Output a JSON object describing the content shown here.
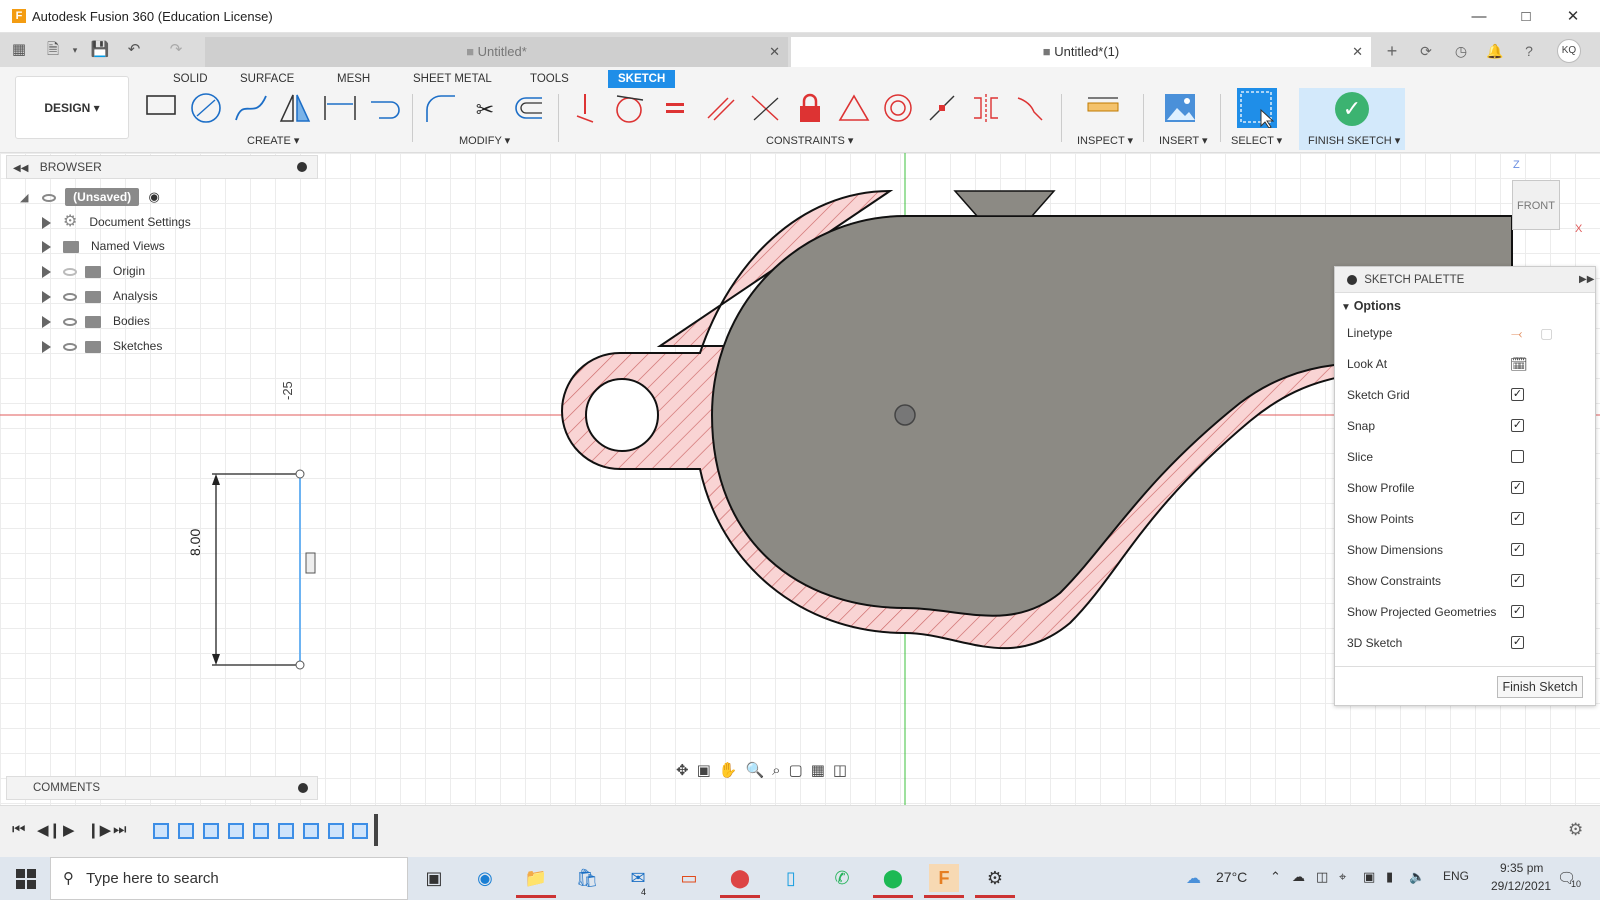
{
  "window": {
    "title": "Autodesk Fusion 360 (Education License)",
    "logo_letter": "F"
  },
  "tabs": [
    {
      "label": "Untitled*",
      "active": false
    },
    {
      "label": "Untitled*(1)",
      "active": true
    }
  ],
  "user_initials": "KQ",
  "workspace": {
    "label": "DESIGN ▾"
  },
  "ribbon_tabs": [
    "SOLID",
    "SURFACE",
    "MESH",
    "SHEET METAL",
    "TOOLS",
    "SKETCH"
  ],
  "ribbon_groups": {
    "create": "CREATE ▾",
    "modify": "MODIFY ▾",
    "constraints": "CONSTRAINTS ▾",
    "inspect": "INSPECT ▾",
    "insert": "INSERT ▾",
    "select": "SELECT ▾",
    "finish": "FINISH SKETCH ▾"
  },
  "browser": {
    "title": "BROWSER",
    "root": "(Unsaved)",
    "items": [
      "Document Settings",
      "Named Views",
      "Origin",
      "Analysis",
      "Bodies",
      "Sketches"
    ]
  },
  "comments": {
    "title": "COMMENTS"
  },
  "dimensions": {
    "horizontal": "-25",
    "vertical": "8.00"
  },
  "viewcube": {
    "face": "FRONT",
    "axis_z": "Z",
    "axis_x": "X"
  },
  "palette": {
    "title": "SKETCH PALETTE",
    "section": "Options",
    "options": [
      {
        "label": "Linetype",
        "kind": "icons"
      },
      {
        "label": "Look At",
        "kind": "icon"
      },
      {
        "label": "Sketch Grid",
        "kind": "check",
        "checked": true
      },
      {
        "label": "Snap",
        "kind": "check",
        "checked": true
      },
      {
        "label": "Slice",
        "kind": "check",
        "checked": false
      },
      {
        "label": "Show Profile",
        "kind": "check",
        "checked": true
      },
      {
        "label": "Show Points",
        "kind": "check",
        "checked": true
      },
      {
        "label": "Show Dimensions",
        "kind": "check",
        "checked": true
      },
      {
        "label": "Show Constraints",
        "kind": "check",
        "checked": true
      },
      {
        "label": "Show Projected Geometries",
        "kind": "check",
        "checked": true
      },
      {
        "label": "3D Sketch",
        "kind": "check",
        "checked": true
      }
    ],
    "finish_button": "Finish Sketch"
  },
  "taskbar": {
    "search_placeholder": "Type here to search",
    "temperature": "27°C",
    "language": "ENG",
    "time": "9:35 pm",
    "date": "29/12/2021",
    "mail_badge": "4",
    "notif_badge": "10"
  }
}
